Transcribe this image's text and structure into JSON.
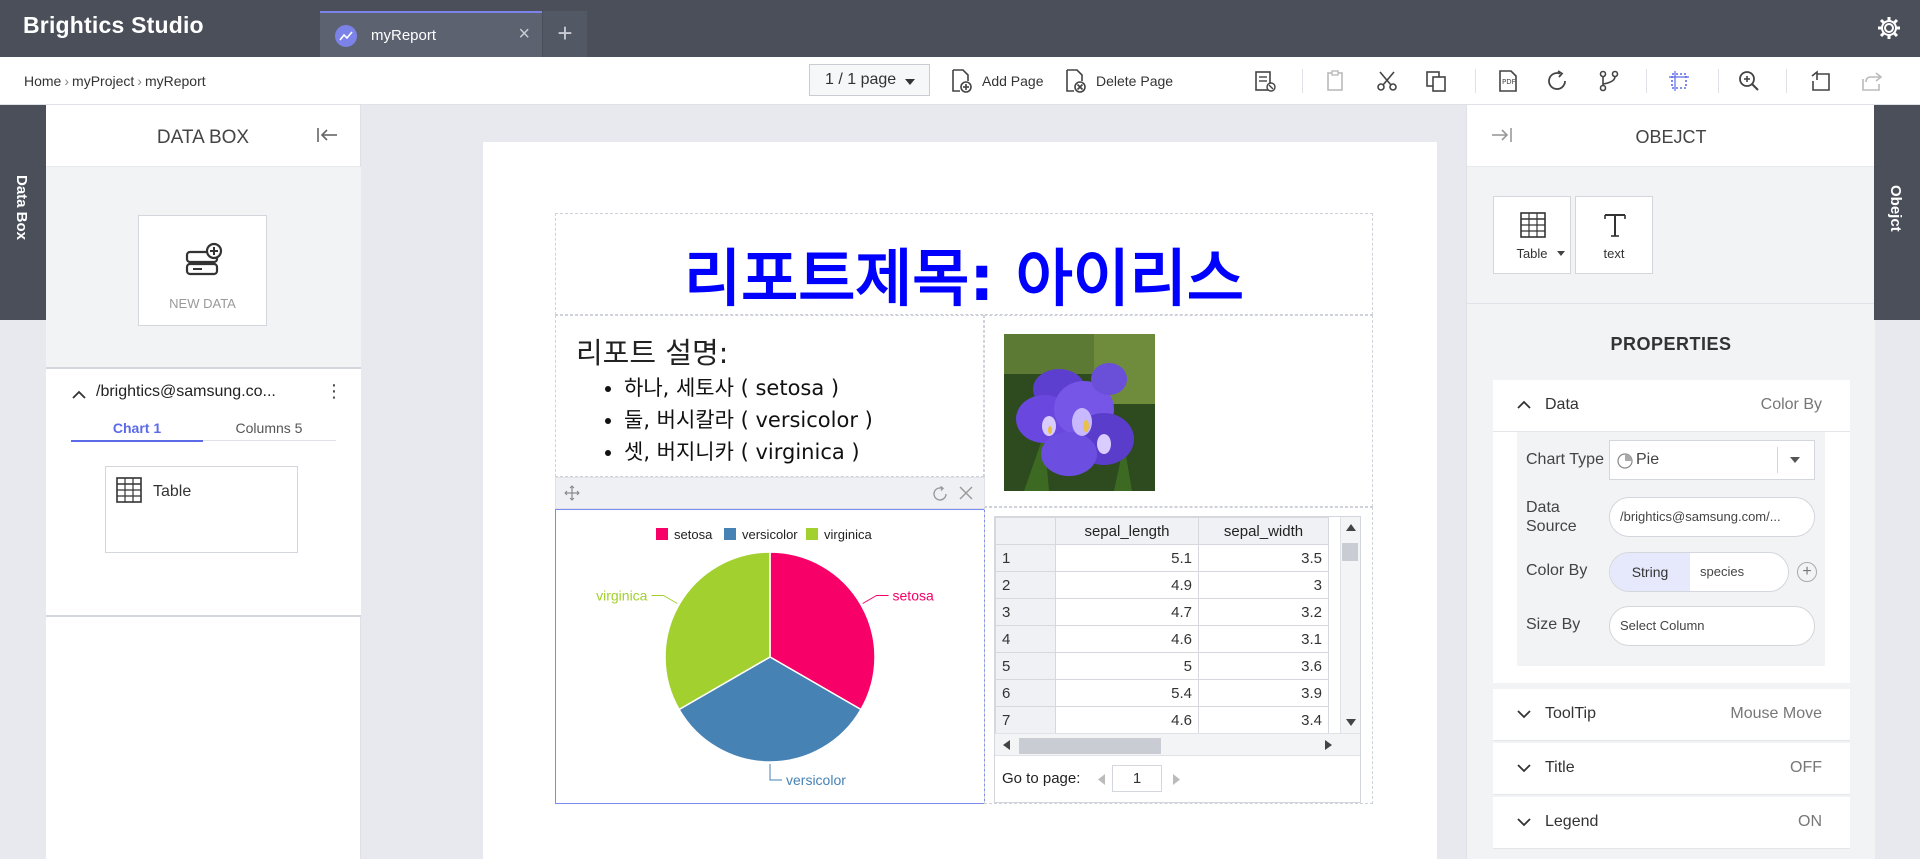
{
  "app": {
    "brand": "Brightics Studio"
  },
  "tabs": [
    {
      "label": "myReport"
    }
  ],
  "breadcrumb": {
    "items": [
      "Home",
      "myProject",
      "myReport"
    ]
  },
  "toolbar": {
    "page_select": "1 / 1 page",
    "add_page_label": "Add Page",
    "delete_page_label": "Delete Page"
  },
  "left_rail": {
    "label": "Data Box"
  },
  "right_rail": {
    "label": "Obejct"
  },
  "databox": {
    "title": "DATA BOX",
    "new_data_label": "NEW DATA",
    "source_title": "/brightics@samsung.co...",
    "subtabs": [
      "Chart 1",
      "Columns 5"
    ],
    "table_card_label": "Table"
  },
  "report": {
    "title": "리포트제목: 아이리스",
    "description_heading": "리포트 설명:",
    "description_items": [
      "하나, 세토사 ( setosa )",
      "둘, 버시칼라 ( versicolor )",
      "셋, 버지니카 ( virginica )"
    ]
  },
  "chart_data": {
    "type": "pie",
    "categories": [
      "setosa",
      "versicolor",
      "virginica"
    ],
    "values": [
      50,
      50,
      50
    ],
    "colors": [
      "#f70068",
      "#4682b4",
      "#a2d02e"
    ],
    "legend": "top",
    "title": ""
  },
  "grid": {
    "columns": [
      "sepal_length",
      "sepal_width"
    ],
    "rows": [
      {
        "idx": "1",
        "vals": [
          "5.1",
          "3.5"
        ]
      },
      {
        "idx": "2",
        "vals": [
          "4.9",
          "3"
        ]
      },
      {
        "idx": "3",
        "vals": [
          "4.7",
          "3.2"
        ]
      },
      {
        "idx": "4",
        "vals": [
          "4.6",
          "3.1"
        ]
      },
      {
        "idx": "5",
        "vals": [
          "5",
          "3.6"
        ]
      },
      {
        "idx": "6",
        "vals": [
          "5.4",
          "3.9"
        ]
      },
      {
        "idx": "7",
        "vals": [
          "4.6",
          "3.4"
        ]
      }
    ],
    "pager_label": "Go to page:",
    "page_value": "1"
  },
  "object_panel": {
    "title": "OBEJCT",
    "tools": [
      "Table",
      "text"
    ],
    "properties_title": "PROPERTIES",
    "data_section": {
      "label": "Data",
      "value": "Color By",
      "chart_type_label": "Chart Type",
      "chart_type_value": "Pie",
      "data_source_label": "Data Source",
      "data_source_value": "/brightics@samsung.com/...",
      "color_by_label": "Color By",
      "color_by_type": "String",
      "color_by_column": "species",
      "size_by_label": "Size By",
      "size_by_placeholder": "Select Column"
    },
    "sections": [
      {
        "label": "ToolTip",
        "value": "Mouse Move"
      },
      {
        "label": "Title",
        "value": "OFF"
      },
      {
        "label": "Legend",
        "value": "ON"
      }
    ]
  }
}
